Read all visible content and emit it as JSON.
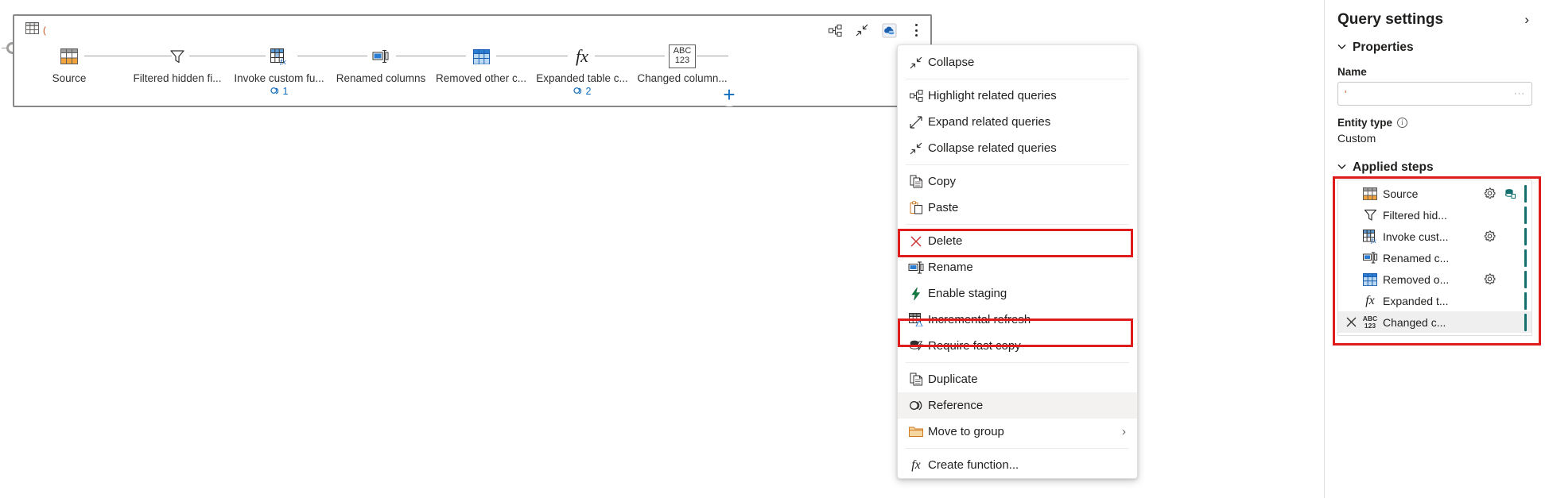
{
  "diagram": {
    "card_title": "(",
    "tools": [
      {
        "name": "highlight-related-queries-icon",
        "label": "Highlight related queries"
      },
      {
        "name": "collapse-icon",
        "label": "Collapse"
      },
      {
        "name": "data-source-settings-icon",
        "label": "Data source settings"
      },
      {
        "name": "more-options-icon",
        "label": "More options"
      }
    ],
    "steps": [
      {
        "label": "Source",
        "icon": "source-table-icon",
        "badge": ""
      },
      {
        "label": "Filtered hidden fi...",
        "icon": "filter-icon",
        "badge": ""
      },
      {
        "label": "Invoke custom fu...",
        "icon": "invoke-function-icon",
        "badge": "1"
      },
      {
        "label": "Renamed columns",
        "icon": "rename-columns-icon",
        "badge": ""
      },
      {
        "label": "Removed other c...",
        "icon": "removed-columns-icon",
        "badge": ""
      },
      {
        "label": "Expanded table c...",
        "icon": "fx-icon",
        "badge": "2"
      },
      {
        "label": "Changed column...",
        "icon": "abc123-icon",
        "badge": ""
      }
    ],
    "add_step_label": "+"
  },
  "context_menu": {
    "groups": [
      [
        {
          "label": "Collapse",
          "icon": "collapse-icon",
          "highlighted": false,
          "selected": false,
          "submenu": false
        }
      ],
      [
        {
          "label": "Highlight related queries",
          "icon": "highlight-related-icon",
          "highlighted": false,
          "selected": false,
          "submenu": false
        },
        {
          "label": "Expand related queries",
          "icon": "expand-related-icon",
          "highlighted": false,
          "selected": false,
          "submenu": false
        },
        {
          "label": "Collapse related queries",
          "icon": "collapse-related-icon",
          "highlighted": false,
          "selected": false,
          "submenu": false
        }
      ],
      [
        {
          "label": "Copy",
          "icon": "copy-icon",
          "highlighted": false,
          "selected": false,
          "submenu": false
        },
        {
          "label": "Paste",
          "icon": "paste-icon",
          "highlighted": false,
          "selected": false,
          "submenu": false
        }
      ],
      [
        {
          "label": "Delete",
          "icon": "delete-icon",
          "highlighted": false,
          "selected": false,
          "submenu": false
        },
        {
          "label": "Rename",
          "icon": "rename-icon",
          "highlighted": false,
          "selected": false,
          "submenu": false
        },
        {
          "label": "Enable staging",
          "icon": "enable-staging-icon",
          "highlighted": true,
          "selected": false,
          "submenu": false
        },
        {
          "label": "Incremental refresh",
          "icon": "incremental-refresh-icon",
          "highlighted": false,
          "selected": false,
          "submenu": false
        },
        {
          "label": "Require fast copy",
          "icon": "fast-copy-icon",
          "highlighted": false,
          "selected": false,
          "submenu": false
        }
      ],
      [
        {
          "label": "Duplicate",
          "icon": "duplicate-icon",
          "highlighted": false,
          "selected": false,
          "submenu": false
        },
        {
          "label": "Reference",
          "icon": "reference-icon",
          "highlighted": true,
          "selected": true,
          "submenu": false
        },
        {
          "label": "Move to group",
          "icon": "folder-icon",
          "highlighted": false,
          "selected": false,
          "submenu": true
        }
      ],
      [
        {
          "label": "Create function...",
          "icon": "fx-icon",
          "highlighted": false,
          "selected": false,
          "submenu": false
        }
      ]
    ],
    "submenu_chevron": "›"
  },
  "query_settings": {
    "title": "Query settings",
    "expand_chevron": "›",
    "properties": {
      "section_label": "Properties",
      "caret": "⌄",
      "name_label": "Name",
      "name_value": "'",
      "name_ellipsis": "···",
      "entity_type_label": "Entity type",
      "entity_type_value": "Custom"
    },
    "applied_steps": {
      "section_label": "Applied steps",
      "caret": "⌄",
      "steps": [
        {
          "name": "Source",
          "icon": "source-table-icon",
          "gear": true,
          "extra": "database-icon",
          "active": false,
          "deletable": false
        },
        {
          "name": "Filtered hid...",
          "icon": "filter-icon",
          "gear": false,
          "extra": "",
          "active": false,
          "deletable": false
        },
        {
          "name": "Invoke cust...",
          "icon": "invoke-function-icon",
          "gear": true,
          "extra": "",
          "active": false,
          "deletable": false
        },
        {
          "name": "Renamed c...",
          "icon": "rename-columns-icon",
          "gear": false,
          "extra": "",
          "active": false,
          "deletable": false
        },
        {
          "name": "Removed o...",
          "icon": "removed-columns-icon",
          "gear": true,
          "extra": "",
          "active": false,
          "deletable": false
        },
        {
          "name": "Expanded t...",
          "icon": "fx-icon",
          "gear": false,
          "extra": "",
          "active": false,
          "deletable": false
        },
        {
          "name": "Changed c...",
          "icon": "abc123-icon",
          "gear": false,
          "extra": "",
          "active": true,
          "deletable": true
        }
      ]
    }
  },
  "colors": {
    "highlight_red": "#e01b1b",
    "accent_blue": "#0f6cbd",
    "step_bar_teal": "#13706e",
    "title_orange": "#c0531f"
  }
}
